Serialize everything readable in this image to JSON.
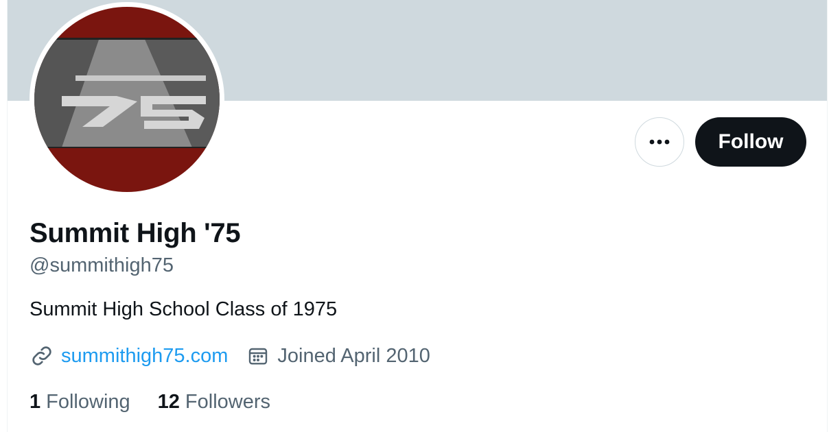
{
  "profile": {
    "display_name": "Summit High '75",
    "handle": "@summithigh75",
    "bio": "Summit High School Class of 1975",
    "website": "summithigh75.com",
    "joined": "Joined April 2010",
    "avatar_alt": "75"
  },
  "actions": {
    "more_icon": "more-horizontal-icon",
    "follow_label": "Follow"
  },
  "stats": {
    "following_count": "1",
    "following_label": "Following",
    "followers_count": "12",
    "followers_label": "Followers"
  },
  "icons": {
    "website": "link-icon",
    "joined": "calendar-icon"
  },
  "colors": {
    "banner": "#cfd9de",
    "avatar_red": "#7a150f",
    "link": "#1d9bf0",
    "secondary_text": "#536471",
    "follow_bg": "#0f1419"
  }
}
